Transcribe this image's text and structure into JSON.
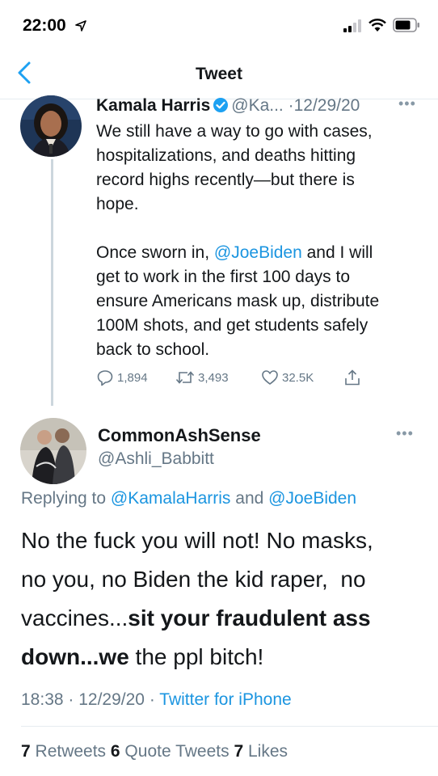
{
  "status_bar": {
    "time": "22:00"
  },
  "nav": {
    "title": "Tweet"
  },
  "parent_tweet": {
    "name": "Kamala Harris",
    "handle": "@Ka...",
    "separator": "·",
    "date": "12/29/20",
    "body_lines_1": [
      "We still have a way to go with cases,",
      "hospitalizations, and deaths hitting",
      "record highs recently—but there is",
      "hope."
    ],
    "body_line_5_before": "Once sworn in, ",
    "body_line_5_mention": "@JoeBiden",
    "body_line_5_after": " and I will",
    "body_lines_2": [
      "get to work in the first 100 days to",
      "ensure Americans mask up, distribute",
      "100M shots, and get students safely",
      "back to school."
    ],
    "replies": "1,894",
    "retweets": "3,493",
    "likes": "32.5K"
  },
  "reply_tweet": {
    "name": "CommonAshSense",
    "handle": "@Ashli_Babbitt",
    "replying_prefix": "Replying to ",
    "replying_mention_1": "@KamalaHarris",
    "replying_and": " and ",
    "replying_mention_2": "@JoeBiden",
    "body_line_1": "No the fuck you will not! No masks,",
    "body_line_2": "no you, no Biden the kid raper,  no",
    "body_line_3_normal": "vaccines...",
    "body_line_3_bold": "sit your fraudulent ass",
    "body_line_4_bold": "down...we",
    "body_line_4_normal": " the ppl bitch!",
    "time": "18:38",
    "date": "12/29/20",
    "separator": " · ",
    "source": "Twitter for iPhone",
    "retweets_count": "7",
    "retweets_label": " Retweets ",
    "quotes_count": "6",
    "quotes_label": " Quote Tweets ",
    "likes_count": "7",
    "likes_label": " Likes"
  },
  "colors": {
    "link": "#1b95e0",
    "muted": "#657786",
    "text": "#14171a",
    "divider": "#e6ecf0"
  }
}
